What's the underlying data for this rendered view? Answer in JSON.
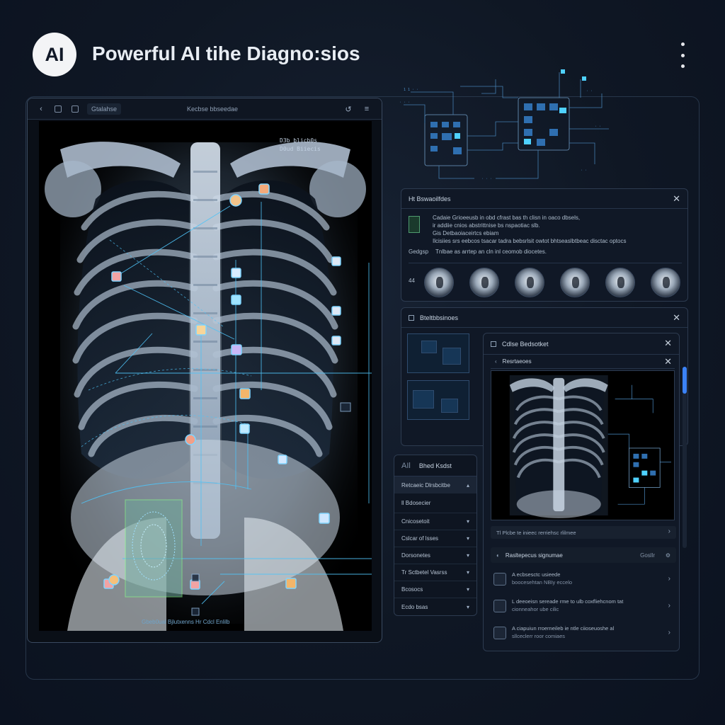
{
  "header": {
    "logo_text": "AI",
    "title": "Powerful AI tihe Diagno:sios"
  },
  "viewer": {
    "path_label": "Gtalahse",
    "title": "Kecbse bbseedae",
    "meta_lines": [
      "D3b blicb0s",
      "D0ud Biiecis"
    ],
    "footer": "Gbeb0ual Bjlutxenns   Hr   Cdcl  Enlilb"
  },
  "findings": {
    "title": "Ht Bswaoilfdes",
    "lines": [
      "Cadaie Grioeeusb in obd cfrast bas th clisn in oaco dbsels,",
      "ir addiie cnios abstrittnise bs nspaotiac slb.",
      "Gis Detbaoiaceirtcs ebiam",
      "Ilcisiies srs eebcos tsacar tadra bebsrlsit owtot bhtseaslbtbeac disctac optocs",
      "Tnlbae as arrtep an cln inl ceomob diocetes."
    ],
    "side_label": "Gedgsp",
    "thumb_label": "44"
  },
  "results": {
    "title": "Bteltbbsinoes"
  },
  "menu": {
    "top_icon": "AIl",
    "top_label": "Bhed Ksdst",
    "active": "Retcaeic   Dlrsbcitbe",
    "section": "ll Bdosecier",
    "items": [
      "Cnicosetoit",
      "Cslcar of lsses",
      "Dorsonetes",
      "Tr Sctbetel Vasrss",
      "Bcosocs",
      "Ecdo bsas"
    ]
  },
  "detail": {
    "title": "Cdlse Bedsotket",
    "subtitle": "Resrtaeoes",
    "bar_text": "Tl Plcbe te inieec rerriehsc rlilmee",
    "sugg_title": "Rasltepecus signumae",
    "sugg_right": "Gosllr",
    "suggestions": [
      {
        "t1": "A ecbsesctc usieede",
        "t2": "boocesehtan NBIy eccelo"
      },
      {
        "t1": "L deeoeisn sereade rme to ulb coxfliehcnom tat",
        "t2": "cionneahor ube cilic"
      },
      {
        "t1": "A ciapuiun rroerneileb ie ntle ciioseuoshe al",
        "t2": "sllceclerr roor comiaes"
      }
    ]
  },
  "colors": {
    "background": "#0f1724",
    "accent": "#4fc3f7",
    "annotation_box": "#88ff88"
  },
  "icons": [
    "back-icon",
    "grid-icon",
    "share-icon",
    "menu-icon",
    "close-icon",
    "chevron-down-icon",
    "chevron-right-icon"
  ]
}
